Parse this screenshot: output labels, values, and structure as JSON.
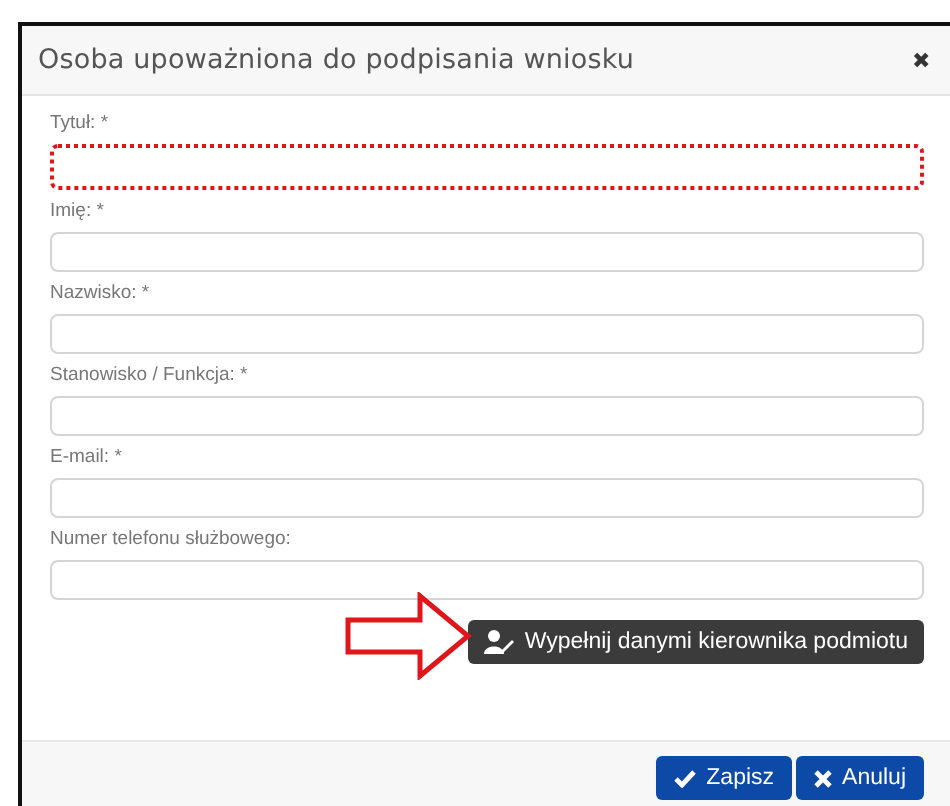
{
  "dialog": {
    "title": "Osoba upoważniona do podpisania wniosku",
    "close": "✖"
  },
  "fields": [
    {
      "label": "Tytuł: *",
      "highlighted": true
    },
    {
      "label": "Imię: *",
      "highlighted": false
    },
    {
      "label": "Nazwisko: *",
      "highlighted": false
    },
    {
      "label": "Stanowisko / Funkcja: *",
      "highlighted": false
    },
    {
      "label": "E-mail: *",
      "highlighted": false
    },
    {
      "label": "Numer telefonu służbowego:",
      "highlighted": false
    }
  ],
  "fill_button": {
    "label": "Wypełnij danymi kierownika podmiotu"
  },
  "buttons": [
    {
      "kind": "save",
      "label": "Zapisz"
    },
    {
      "kind": "cancel",
      "label": "Anuluj"
    }
  ]
}
